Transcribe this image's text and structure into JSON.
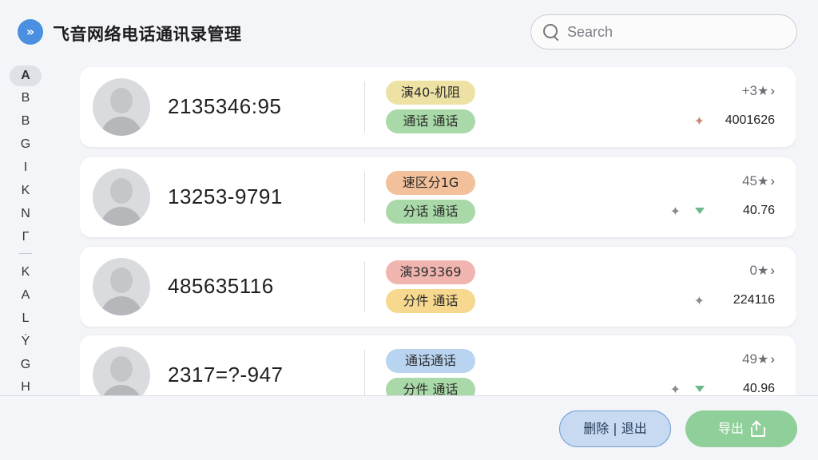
{
  "app": {
    "title": "飞音网络电话通讯录管理",
    "logo_icon": "chevron-double-down-icon",
    "accent_color": "#4a8fe0"
  },
  "search": {
    "placeholder": "Search",
    "value": ""
  },
  "alphabet_index": {
    "active": "A",
    "letters": [
      "A",
      "B",
      "B",
      "G",
      "I",
      "K",
      "N",
      "Γ",
      "K",
      "A",
      "L",
      "Ẏ",
      "G",
      "H"
    ]
  },
  "contacts": [
    {
      "phone": "2135346:95",
      "tag_top": {
        "text": "演40-机阻",
        "color": "#ede2a4"
      },
      "tag_bottom": {
        "text": "通话 通话",
        "color": "#a9d9a8"
      },
      "rating": "+3",
      "metric_icon": "sparkle-warm-icon",
      "trend_down": false,
      "metric_value": "4001626"
    },
    {
      "phone": "13253-9791",
      "tag_top": {
        "text": "速区分1G",
        "color": "#f2c09a"
      },
      "tag_bottom": {
        "text": "分话 通话",
        "color": "#a9d9a8"
      },
      "rating": "45",
      "metric_icon": "sparkle-icon",
      "trend_down": true,
      "metric_value": "40.76"
    },
    {
      "phone": "485635116",
      "tag_top": {
        "text": "演393369",
        "color": "#f1b5b0"
      },
      "tag_bottom": {
        "text": "分件 通话",
        "color": "#f6d88f"
      },
      "rating": "0",
      "metric_icon": "sparkle-icon",
      "trend_down": false,
      "metric_value": "224116"
    },
    {
      "phone": "2317=?-947",
      "tag_top": {
        "text": "通话通话",
        "color": "#b9d4f0"
      },
      "tag_bottom": {
        "text": "分件 通话",
        "color": "#a9d9a8"
      },
      "rating": "49",
      "metric_icon": "sparkle-icon",
      "trend_down": true,
      "metric_value": "40.96"
    }
  ],
  "footer": {
    "secondary_button": "删除 | 退出",
    "primary_button": "导出"
  }
}
